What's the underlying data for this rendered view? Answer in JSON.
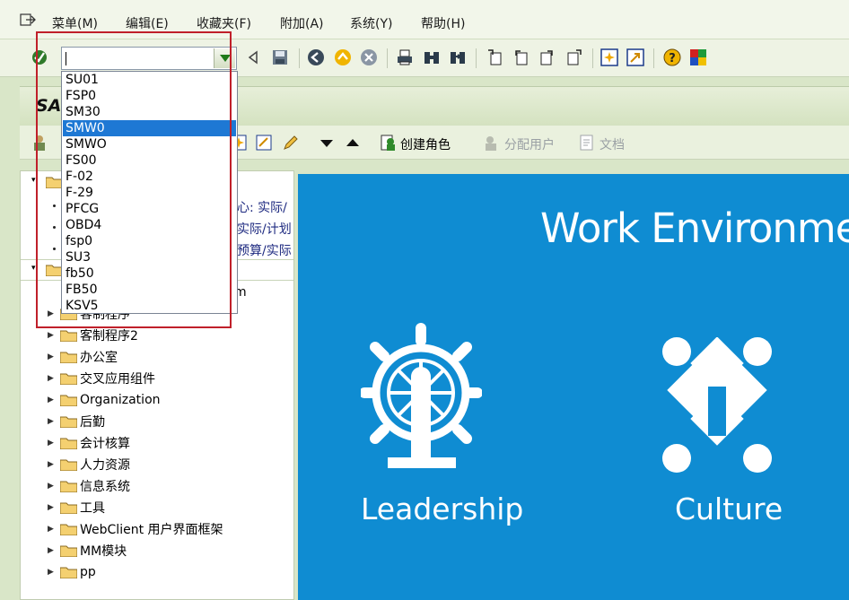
{
  "menubar": {
    "items": [
      "菜单(M)",
      "编辑(E)",
      "收藏夹(F)",
      "附加(A)",
      "系统(Y)",
      "帮助(H)"
    ]
  },
  "command_field": {
    "value": "",
    "options": [
      "SU01",
      "FSP0",
      "SM30",
      "SMW0",
      "SMWO",
      "FS00",
      "F-02",
      "F-29",
      "PFCG",
      "OBD4",
      "fsp0",
      "SU3",
      "fb50",
      "FB50",
      "KSV5"
    ],
    "selected": "SMW0"
  },
  "title": {
    "text": "SA"
  },
  "app_toolbar": {
    "create_role": "创建角色",
    "assign_users": "分配用户",
    "documentation": "文档"
  },
  "tree": {
    "partial_texts": [
      "心: 实际/",
      "实际/计划",
      "预算/实际"
    ],
    "partial_m": "m",
    "partial_row": "客制程序",
    "folders": [
      "客制程序2",
      "办公室",
      "交叉应用组件",
      "Organization",
      "后勤",
      "会计核算",
      "人力资源",
      "信息系统",
      "工具",
      "WebClient 用户界面框架",
      "MM模块",
      "pp"
    ]
  },
  "welcome": {
    "heading": "Work Environme",
    "cards": [
      "Leadership",
      "Culture"
    ]
  },
  "colors": {
    "blue_panel": "#0f8cd2",
    "highlight": "#c0202a",
    "selection": "#1e78d4"
  }
}
